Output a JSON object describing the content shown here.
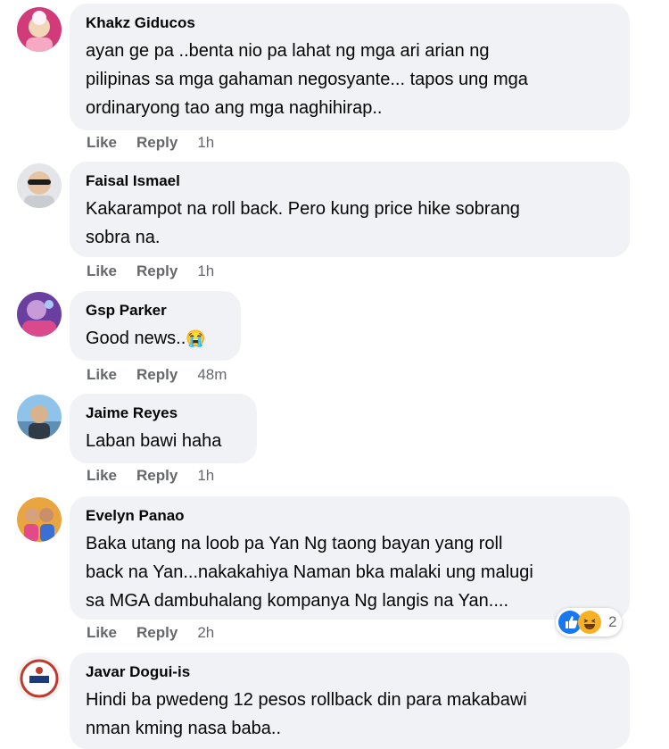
{
  "actions": {
    "like": "Like",
    "reply": "Reply"
  },
  "comments": [
    {
      "name": "Khakz Giducos",
      "text": "ayan ge pa ..benta nio pa lahat ng mga ari arian ng\npilipinas sa mga gahaman negosyante... tapos ung mga\nordinaryong tao ang mga naghihirap..",
      "time": "1h"
    },
    {
      "name": "Faisal Ismael",
      "text": "Kakarampot na roll back. Pero kung price hike sobrang\nsobra na.",
      "time": "1h"
    },
    {
      "name": "Gsp Parker",
      "text": "Good news..",
      "emoji": "😭",
      "time": "48m"
    },
    {
      "name": "Jaime Reyes",
      "text": "Laban bawi haha",
      "time": "1h"
    },
    {
      "name": "Evelyn Panao",
      "text": "Baka utang na loob pa Yan Ng taong bayan yang roll\nback na Yan...nakakahiya Naman bka malaki ung malugi\nsa MGA dambuhalang kompanya Ng langis na Yan....",
      "time": "2h",
      "reactions": {
        "icons": [
          "like-icon",
          "haha-icon"
        ],
        "count": "2"
      }
    },
    {
      "name": "Javar Dogui-is",
      "text": "Hindi ba pwedeng 12 pesos rollback din para makabawi\nnman kming nasa baba.."
    }
  ],
  "colors": {
    "bubble": "#f0f2f5",
    "meta": "#65676b",
    "like_blue": "#1877f2",
    "haha_yellow": "#f7b125"
  }
}
